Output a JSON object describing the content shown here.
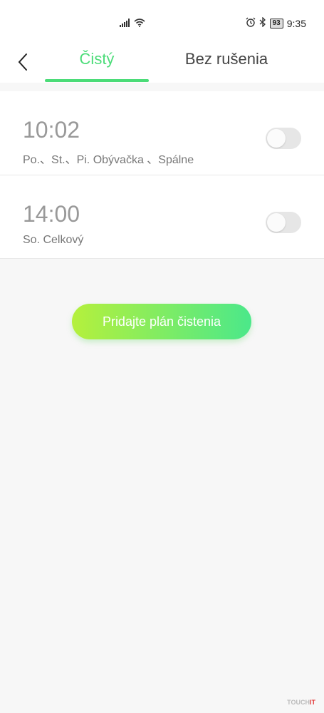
{
  "status_bar": {
    "battery": "93",
    "time": "9:35"
  },
  "header": {
    "tabs": [
      {
        "label": "Čistý",
        "active": true
      },
      {
        "label": "Bez rušenia",
        "active": false
      }
    ]
  },
  "schedules": [
    {
      "time": "10:02",
      "description": "Po.、St.、Pi. Obývačka 、Spálne",
      "enabled": false
    },
    {
      "time": "14:00",
      "description": "So. Celkový",
      "enabled": false
    }
  ],
  "add_button_label": "Pridajte plán čistenia",
  "colors": {
    "accent": "#4bdc78",
    "button_gradient_start": "#b5f03c",
    "button_gradient_end": "#4be88a"
  },
  "watermark": {
    "text": "TOUCH",
    "suffix": "IT"
  }
}
